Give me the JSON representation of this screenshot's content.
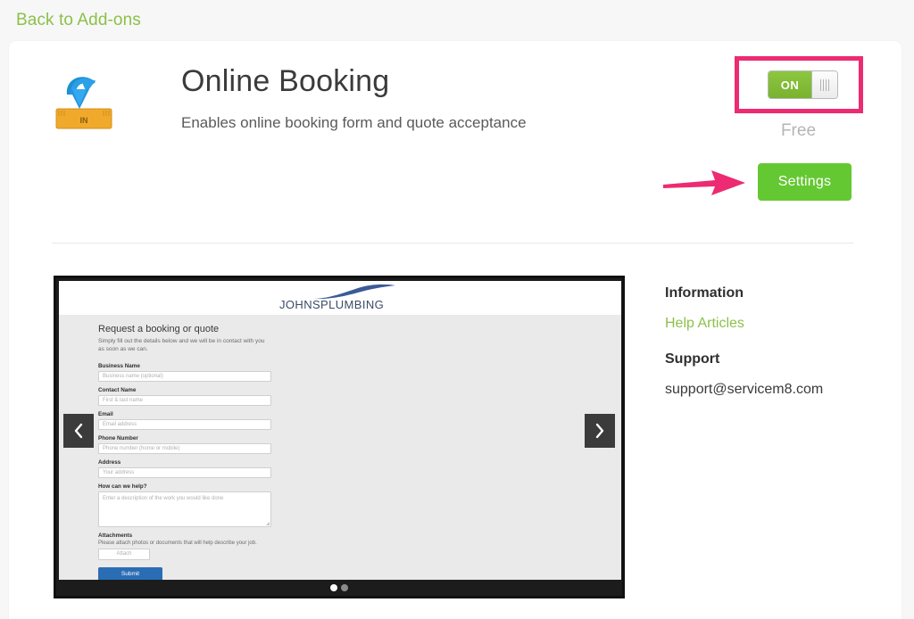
{
  "nav": {
    "back_label": "Back to Add-ons"
  },
  "header": {
    "icon_name": "inbox-download-icon",
    "title": "Online Booking",
    "subtitle": "Enables online booking form and quote acceptance",
    "toggle_state_label": "ON",
    "price_label": "Free",
    "settings_label": "Settings"
  },
  "annotations": {
    "highlight_color": "#ec2b72",
    "arrow_color": "#ec2b72",
    "accent_green": "#64c832",
    "link_green": "#8cc04a"
  },
  "preview": {
    "prev_label": "‹",
    "next_label": "›",
    "dots": [
      {
        "active": true
      },
      {
        "active": false
      }
    ],
    "logo_text": "JOHNSPLUMBING",
    "form": {
      "heading": "Request a booking or quote",
      "intro": "Simply fill out the details below and we will be in contact with you as soon as we can.",
      "fields": [
        {
          "label": "Business Name",
          "placeholder": "Business name (optional)",
          "type": "text"
        },
        {
          "label": "Contact Name",
          "placeholder": "First & last name",
          "type": "text"
        },
        {
          "label": "Email",
          "placeholder": "Email address",
          "type": "text"
        },
        {
          "label": "Phone Number",
          "placeholder": "Phone number (home or mobile)",
          "type": "text"
        },
        {
          "label": "Address",
          "placeholder": "Your address",
          "type": "text"
        },
        {
          "label": "How can we help?",
          "placeholder": "Enter a description of the work you would like done",
          "type": "textarea"
        }
      ],
      "attachments_label": "Attachments",
      "attachments_note": "Please attach photos or documents that will help describe your job.",
      "attach_button": "Attach",
      "submit_button": "Submit"
    }
  },
  "sidebar": {
    "information_heading": "Information",
    "help_articles_link": "Help Articles",
    "support_heading": "Support",
    "support_email": "support@servicem8.com"
  }
}
